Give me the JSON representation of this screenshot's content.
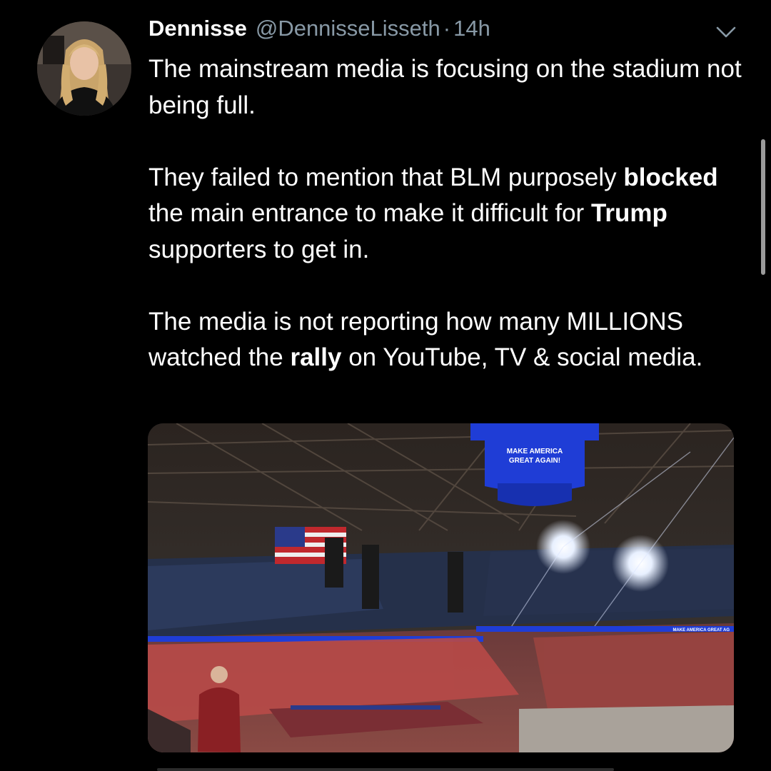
{
  "tweet": {
    "author": {
      "display_name": "Dennisse",
      "handle": "@DennisseLisseth",
      "separator": "·",
      "timestamp": "14h",
      "avatar_icon": "user-avatar"
    },
    "menu_icon": "chevron-down-icon",
    "paragraphs": {
      "p1": "The mainstream media is focusing on the stadium not being full.",
      "p2": {
        "a": "They failed to mention that BLM purposely ",
        "b": "blocked",
        "c": " the main entrance to make it difficult for ",
        "d": "Trump",
        "e": " supporters to get in."
      },
      "p3": {
        "a": "The media is not reporting how many MILLIONS watched the ",
        "b": "rally",
        "c": " on YouTube, TV & social media."
      }
    },
    "media": {
      "scoreboard_text": "MAKE AMERICA GREAT AGAIN!",
      "banner_text": "MAKE AMERICA GREAT AG"
    }
  },
  "colors": {
    "background": "#000000",
    "text": "#ffffff",
    "muted": "#8899a6",
    "scoreboard": "#1f3dd6"
  }
}
